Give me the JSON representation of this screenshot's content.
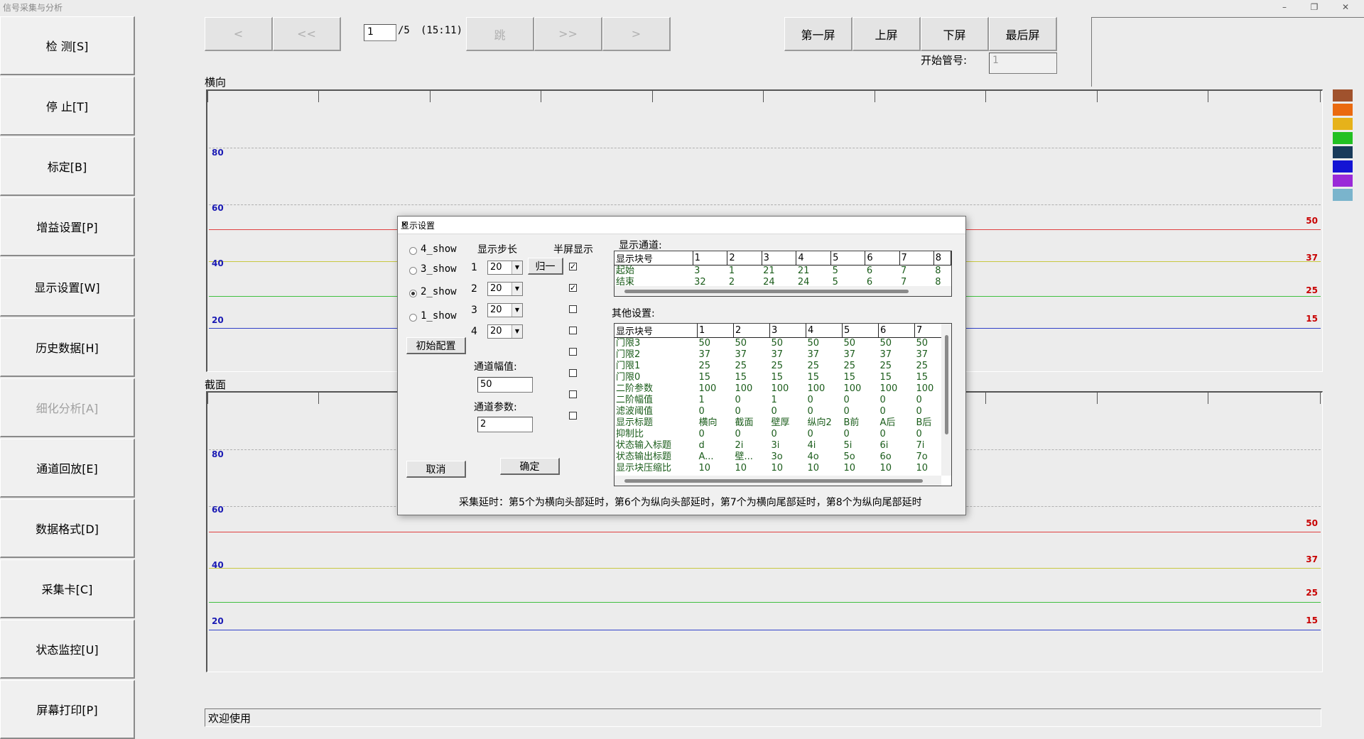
{
  "window": {
    "title": "信号采集与分析",
    "minimize": "–",
    "restore": "❐",
    "close": "✕"
  },
  "sidebar": [
    {
      "label": "检  测[S]",
      "enabled": true
    },
    {
      "label": "停 止[T]",
      "enabled": true
    },
    {
      "label": "标定[B]",
      "enabled": true
    },
    {
      "label": "增益设置[P]",
      "enabled": true
    },
    {
      "label": "显示设置[W]",
      "enabled": true
    },
    {
      "label": "历史数据[H]",
      "enabled": true
    },
    {
      "label": "细化分析[A]",
      "enabled": false
    },
    {
      "label": "通道回放[E]",
      "enabled": true
    },
    {
      "label": "数据格式[D]",
      "enabled": true
    },
    {
      "label": "采集卡[C]",
      "enabled": true
    },
    {
      "label": "状态监控[U]",
      "enabled": true
    },
    {
      "label": "屏幕打印[P]",
      "enabled": true
    }
  ],
  "toolbar": {
    "prev": "<",
    "prev_fast": "<<",
    "page_value": "1",
    "page_total": "/5",
    "time": "(15:11)",
    "jump": "跳",
    "next_fast": ">>",
    "next": ">",
    "first_screen": "第一屏",
    "prev_screen": "上屏",
    "next_screen": "下屏",
    "last_screen": "最后屏",
    "start_pipe_label": "开始管号:",
    "start_pipe_value": "1"
  },
  "plots": {
    "top_title": "横向",
    "bottom_title": "截面",
    "y_labels": [
      "80",
      "60",
      "40",
      "20"
    ],
    "right_labels": [
      "50",
      "37",
      "25",
      "15"
    ]
  },
  "colors": {
    "line_50": "#e04040",
    "line_37": "#c8c840",
    "line_25": "#40c040",
    "line_15": "#3040c8",
    "swatches": [
      "#a0522d",
      "#ea6a10",
      "#e6b21a",
      "#22c022",
      "#183a5a",
      "#1414d4",
      "#9a2ad8",
      "#7ab4cc"
    ]
  },
  "statusbar": {
    "text": "欢迎使用"
  },
  "dialog": {
    "title": "显示设置",
    "close": "✕",
    "radio_options": [
      "4_show",
      "3_show",
      "2_show",
      "1_show"
    ],
    "selected_radio": "2_show",
    "step_label": "显示步长",
    "half_screen_label": "半屏显示",
    "steps": [
      {
        "num": "1",
        "value": "20"
      },
      {
        "num": "2",
        "value": "20"
      },
      {
        "num": "3",
        "value": "20"
      },
      {
        "num": "4",
        "value": "20"
      }
    ],
    "normalize_button": "归一",
    "init_config_button": "初始配置",
    "half_checks": [
      true,
      true,
      false,
      false,
      false,
      false,
      false,
      false
    ],
    "channel_amp_label": "通道幅值:",
    "channel_amp_value": "50",
    "channel_param_label": "通道参数:",
    "channel_param_value": "2",
    "cancel_button": "取消",
    "ok_button": "确定",
    "display_channel_label": "显示通道:",
    "display_table": {
      "headers": [
        "显示块号",
        "1",
        "2",
        "3",
        "4",
        "5",
        "6",
        "7",
        "8"
      ],
      "rows": [
        [
          "起始",
          "3",
          "1",
          "21",
          "21",
          "5",
          "6",
          "7",
          "8"
        ],
        [
          "结束",
          "32",
          "2",
          "24",
          "24",
          "5",
          "6",
          "7",
          "8"
        ]
      ]
    },
    "other_settings_label": "其他设置:",
    "other_table": {
      "headers": [
        "显示块号",
        "1",
        "2",
        "3",
        "4",
        "5",
        "6",
        "7"
      ],
      "rows": [
        [
          "门限3",
          "50",
          "50",
          "50",
          "50",
          "50",
          "50",
          "50"
        ],
        [
          "门限2",
          "37",
          "37",
          "37",
          "37",
          "37",
          "37",
          "37"
        ],
        [
          "门限1",
          "25",
          "25",
          "25",
          "25",
          "25",
          "25",
          "25"
        ],
        [
          "门限0",
          "15",
          "15",
          "15",
          "15",
          "15",
          "15",
          "15"
        ],
        [
          "二阶参数",
          "100",
          "100",
          "100",
          "100",
          "100",
          "100",
          "100"
        ],
        [
          "二阶幅值",
          "1",
          "0",
          "1",
          "0",
          "0",
          "0",
          "0"
        ],
        [
          "滤波阈值",
          "0",
          "0",
          "0",
          "0",
          "0",
          "0",
          "0"
        ],
        [
          "显示标题",
          "横向",
          "截面",
          "壁厚",
          "纵向2",
          "B前",
          "A后",
          "B后"
        ],
        [
          "抑制比",
          "0",
          "0",
          "0",
          "0",
          "0",
          "0",
          "0"
        ],
        [
          "状态输入标题",
          "d",
          "2i",
          "3i",
          "4i",
          "5i",
          "6i",
          "7i"
        ],
        [
          "状态输出标题",
          "A...",
          "壁...",
          "3o",
          "4o",
          "5o",
          "6o",
          "7o"
        ],
        [
          "显示块压缩比",
          "10",
          "10",
          "10",
          "10",
          "10",
          "10",
          "10"
        ]
      ]
    },
    "note": "采集延时：第5个为横向头部延时，第6个为纵向头部延时，第7个为横向尾部延时，第8个为纵向尾部延时"
  }
}
